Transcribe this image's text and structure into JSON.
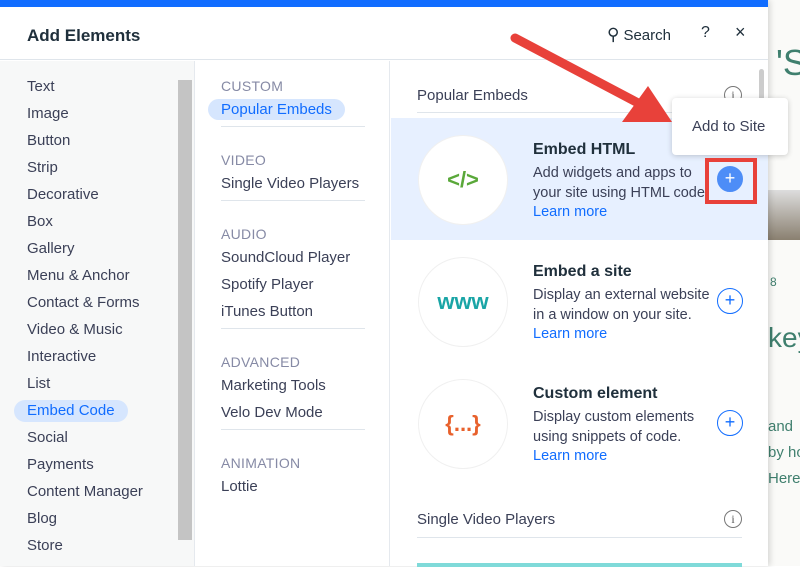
{
  "header": {
    "title": "Add Elements",
    "search_label": "Search",
    "help": "?",
    "close": "×"
  },
  "categories": [
    "Text",
    "Image",
    "Button",
    "Strip",
    "Decorative",
    "Box",
    "Gallery",
    "Menu & Anchor",
    "Contact & Forms",
    "Video & Music",
    "Interactive",
    "List",
    "Embed Code",
    "Social",
    "Payments",
    "Content Manager",
    "Blog",
    "Store"
  ],
  "selected_category": "Embed Code",
  "subcategories": [
    {
      "section": "CUSTOM",
      "items": [
        "Popular Embeds"
      ]
    },
    {
      "section": "VIDEO",
      "items": [
        "Single Video Players"
      ]
    },
    {
      "section": "AUDIO",
      "items": [
        "SoundCloud Player",
        "Spotify Player",
        "iTunes Button"
      ]
    },
    {
      "section": "ADVANCED",
      "items": [
        "Marketing Tools",
        "Velo Dev Mode"
      ]
    },
    {
      "section": "ANIMATION",
      "items": [
        "Lottie"
      ]
    }
  ],
  "selected_subcategory": "Popular Embeds",
  "content": {
    "section1": "Popular Embeds",
    "section2": "Single Video Players",
    "learn_more": "Learn more",
    "cards": [
      {
        "title": "Embed HTML",
        "desc": "Add widgets and apps to your site using HTML code.",
        "icon": "</>",
        "icon_color": "#5aa83a"
      },
      {
        "title": "Embed a site",
        "desc": "Display an external website in a window on your site.",
        "icon": "www",
        "icon_color": "#1aa5a6"
      },
      {
        "title": "Custom element",
        "desc": "Display custom elements using snippets of code.",
        "icon": "{...}",
        "icon_color": "#e8612c"
      }
    ]
  },
  "tooltip": "Add to Site",
  "background_text": [
    "'S",
    "8",
    "key",
    "and",
    "by ho",
    "Here"
  ],
  "colors": {
    "accent": "#116dff",
    "annotation": "#e8413a"
  }
}
